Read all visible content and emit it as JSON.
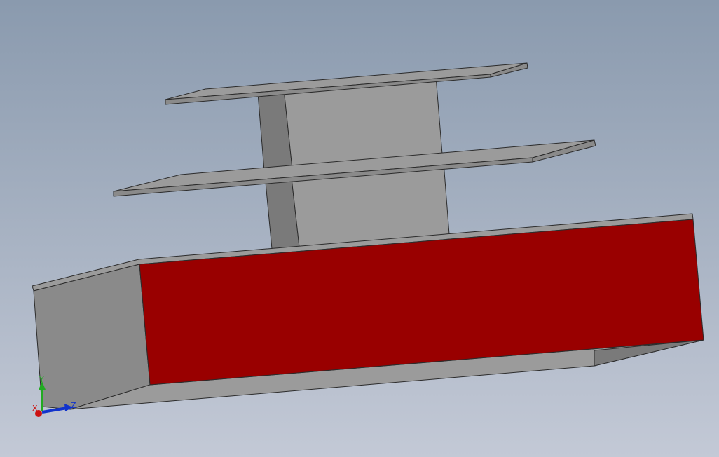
{
  "viewport": {
    "background_top": "#8a9aae",
    "background_bottom": "#c3c9d6"
  },
  "colors": {
    "selected_face": "#990000",
    "light_face": "#9b9b9b",
    "mid_face": "#8a8a8a",
    "dark_face": "#7a7a7a",
    "edge": "#2b2b2b",
    "axis_x": "#cc1111",
    "axis_y": "#22aa22",
    "axis_z": "#1133cc"
  },
  "triad": {
    "x_label": "X",
    "y_label": "Y",
    "z_label": "Z"
  }
}
